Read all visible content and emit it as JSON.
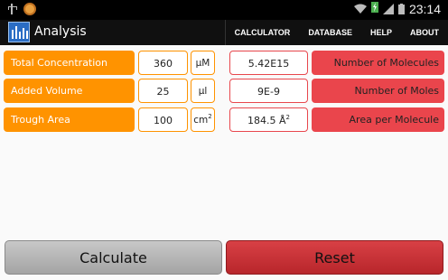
{
  "status_bar": {
    "time": "23:14",
    "icons": [
      "usb-icon",
      "app-notification-icon",
      "wifi-icon",
      "charging-icon",
      "signal-icon",
      "battery-icon"
    ]
  },
  "action_bar": {
    "title": "Analysis",
    "menu": [
      "CALCULATOR",
      "DATABASE",
      "HELP",
      "ABOUT"
    ]
  },
  "rows": [
    {
      "label": "Total Concentration",
      "input": "360",
      "unit": "μM",
      "result": "5.42E15",
      "result_label": "Number of Molecules"
    },
    {
      "label": "Added Volume",
      "input": "25",
      "unit": "μl",
      "result": "9E-9",
      "result_label": "Number of Moles"
    },
    {
      "label": "Trough Area",
      "input": "100",
      "unit_base": "cm",
      "unit_sup": "2",
      "result_base": "184.5 Å",
      "result_sup": "2",
      "result_label": "Area per Molecule"
    }
  ],
  "buttons": {
    "calculate": "Calculate",
    "reset": "Reset"
  },
  "colors": {
    "orange": "#ff9300",
    "red": "#ea454c",
    "action_bar": "#101010"
  }
}
